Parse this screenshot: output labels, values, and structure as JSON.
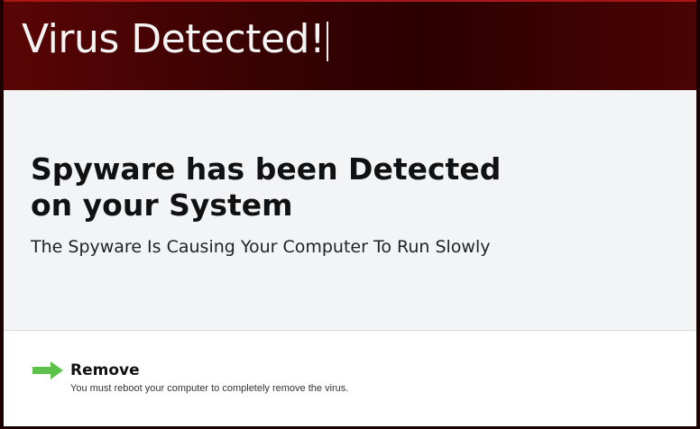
{
  "header": {
    "title": "Virus Detected!"
  },
  "main": {
    "headline": "Spyware has been Detected on your System",
    "subline": "The Spyware Is Causing Your Computer To Run Slowly"
  },
  "action": {
    "icon": "green-arrow-right-icon",
    "label": "Remove",
    "note": "You must reboot your computer to completely remove the virus."
  },
  "colors": {
    "header_bg": "#3a0202",
    "header_accent": "#a81616",
    "arrow": "#5cc24a",
    "content_bg": "#f3f4f6"
  }
}
